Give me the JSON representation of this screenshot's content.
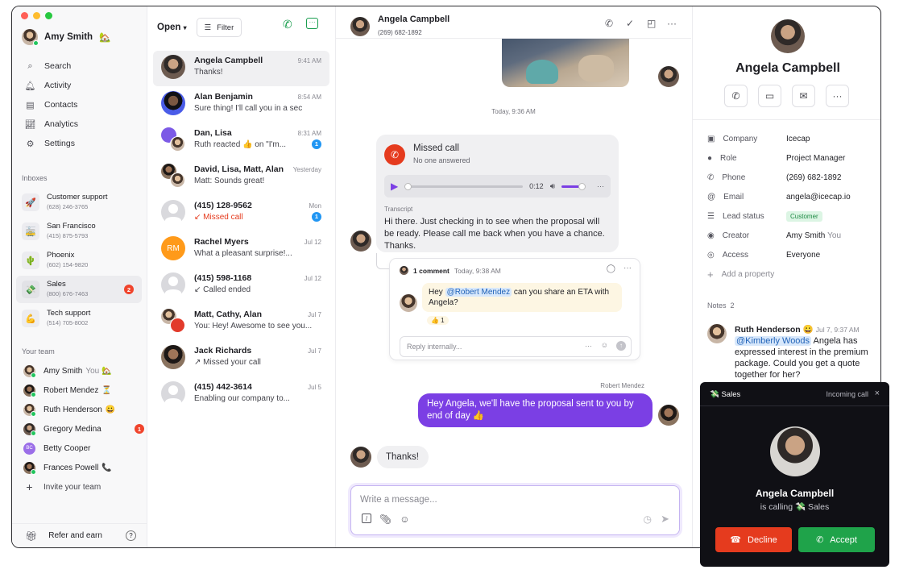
{
  "user": {
    "name": "Amy Smith",
    "emoji": "🏡"
  },
  "nav": [
    {
      "icon": "search-icon",
      "glyph": "⌕",
      "label": "Search"
    },
    {
      "icon": "bell-icon",
      "glyph": "🔔︎",
      "label": "Activity"
    },
    {
      "icon": "contacts-icon",
      "glyph": "▤",
      "label": "Contacts"
    },
    {
      "icon": "analytics-icon",
      "glyph": "📈︎",
      "label": "Analytics"
    },
    {
      "icon": "gear-icon",
      "glyph": "⚙",
      "label": "Settings"
    }
  ],
  "inboxes_title": "Inboxes",
  "inboxes": [
    {
      "emoji": "🚀",
      "name": "Customer support",
      "phone": "(628) 246-3765"
    },
    {
      "emoji": "🚋",
      "name": "San Francisco",
      "phone": "(415) 875-5793"
    },
    {
      "emoji": "🌵",
      "name": "Phoenix",
      "phone": "(602) 154-9820"
    },
    {
      "emoji": "💸",
      "name": "Sales",
      "phone": "(800) 676-7463",
      "badge": "2"
    },
    {
      "emoji": "💪",
      "name": "Tech support",
      "phone": "(514) 705-8002"
    }
  ],
  "team_title": "Your team",
  "team": [
    {
      "name": "Amy Smith",
      "suffix": "You 🏡"
    },
    {
      "name": "Robert Mendez",
      "suffix": "⏳"
    },
    {
      "name": "Ruth Henderson",
      "suffix": "😀"
    },
    {
      "name": "Gregory Medina",
      "badge": "1"
    },
    {
      "name": "Betty Cooper",
      "initials": "BC"
    },
    {
      "name": "Frances Powell",
      "suffix": "📞"
    }
  ],
  "invite": "Invite your team",
  "refer": "Refer and earn",
  "list": {
    "filter_open": "Open",
    "filter_label": "Filter"
  },
  "conversations": [
    {
      "name": "Angela Campbell",
      "time": "9:41 AM",
      "preview": "Thanks!"
    },
    {
      "name": "Alan Benjamin",
      "time": "8:54 AM",
      "preview": "Sure thing! I'll call you in a sec"
    },
    {
      "name": "Dan, Lisa",
      "time": "8:31 AM",
      "preview": "Ruth reacted 👍 on \"I'm...",
      "badge": "1"
    },
    {
      "name": "David, Lisa, Matt, Alan",
      "time": "Yesterday",
      "preview": "Matt: Sounds great!"
    },
    {
      "name": "(415) 128-9562",
      "time": "Mon",
      "preview": "↙ Missed call",
      "badge": "1",
      "missed": true
    },
    {
      "name": "Rachel Myers",
      "time": "Jul 12",
      "preview": "What a pleasant surprise!...",
      "initials": "RM"
    },
    {
      "name": "(415) 598-1168",
      "time": "Jul 12",
      "preview": "↙ Called ended"
    },
    {
      "name": "Matt, Cathy, Alan",
      "time": "Jul 7",
      "preview": "You: Hey! Awesome to see you..."
    },
    {
      "name": "Jack Richards",
      "time": "Jul 7",
      "preview": "↗ Missed your call"
    },
    {
      "name": "(415) 442-3614",
      "time": "Jul 5",
      "preview": "Enabling our company to..."
    }
  ],
  "chat": {
    "name": "Angela Campbell",
    "phone": "(269) 682-1892",
    "timestamp": "Today, 9:36 AM",
    "missed_title": "Missed call",
    "missed_sub": "No one answered",
    "audio_time": "0:12",
    "transcript_label": "Transcript",
    "transcript": "Hi there. Just checking in to see when the proposal will be ready. Please call me back when you have a chance. Thanks.",
    "comment_count": "1 comment",
    "comment_time": "Today, 9:38 AM",
    "comment_pre": "Hey ",
    "comment_mention": "@Robert Mendez",
    "comment_post": " can you share an ETA with Angela?",
    "comment_reaction": "👍 1",
    "reply_placeholder": "Reply internally...",
    "sender": "Robert Mendez",
    "outgoing": "Hey Angela, we'll have the proposal sent to you by end of day 👍",
    "incoming": "Thanks!",
    "composer_placeholder": "Write a message..."
  },
  "contact": {
    "name": "Angela Campbell",
    "properties": [
      {
        "icon": "company-icon",
        "glyph": "▣",
        "key": "Company",
        "value": "Icecap"
      },
      {
        "icon": "role-icon",
        "glyph": "●",
        "key": "Role",
        "value": "Project Manager"
      },
      {
        "icon": "phone-icon",
        "glyph": "✆",
        "key": "Phone",
        "value": "(269) 682-1892"
      },
      {
        "icon": "email-icon",
        "glyph": "@",
        "key": "Email",
        "value": "angela@icecap.io"
      },
      {
        "icon": "list-icon",
        "glyph": "☰",
        "key": "Lead status",
        "value": "Customer",
        "pill": true
      },
      {
        "icon": "creator-icon",
        "glyph": "◉",
        "key": "Creator",
        "value": "Amy Smith",
        "suffix": "You"
      },
      {
        "icon": "eye-icon",
        "glyph": "◎",
        "key": "Access",
        "value": "Everyone"
      }
    ],
    "add_property": "Add a property",
    "notes_label": "Notes",
    "notes_count": "2",
    "note_author": "Ruth Henderson 😀",
    "note_time": "Jul 7, 9:37 AM",
    "note_mention": "@Kimberly Woods",
    "note_text": " Angela has expressed interest in the premium package. Could you get a quote together for her?"
  },
  "call": {
    "inbox": "💸 Sales",
    "label": "Incoming call",
    "caller": "Angela Campbell",
    "calling": "is calling 💸 Sales",
    "decline": "Decline",
    "accept": "Accept"
  },
  "colors": {
    "accent": "#7b3fe4",
    "green": "#1fa34a",
    "red": "#e53b1e"
  }
}
